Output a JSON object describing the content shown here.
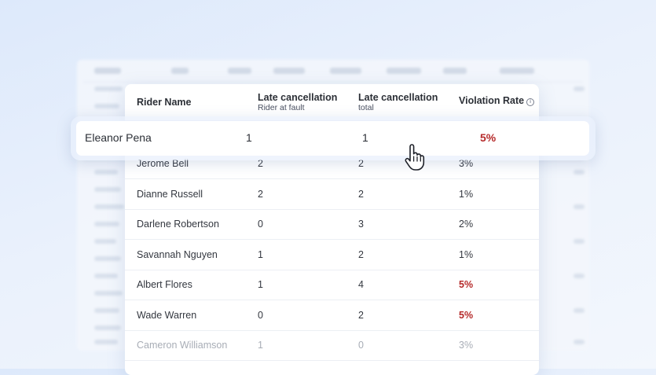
{
  "header": {
    "rider_name": "Rider Name",
    "late_fault_title": "Late cancellation",
    "late_fault_sub": "Rider at fault",
    "late_total_title": "Late cancellation",
    "late_total_sub": "total",
    "violation_rate": "Violation Rate",
    "info_icon": "info-icon"
  },
  "highlighted_row": {
    "name": "Eleanor Pena",
    "fault": "1",
    "total": "1",
    "rate": "5%"
  },
  "rows": [
    {
      "name": "Jerome Bell",
      "fault": "2",
      "total": "2",
      "rate": "3%"
    },
    {
      "name": "Dianne Russell",
      "fault": "2",
      "total": "2",
      "rate": "1%"
    },
    {
      "name": "Darlene Robertson",
      "fault": "0",
      "total": "3",
      "rate": "2%"
    },
    {
      "name": "Savannah Nguyen",
      "fault": "1",
      "total": "2",
      "rate": "1%"
    },
    {
      "name": "Albert Flores",
      "fault": "1",
      "total": "4",
      "rate": "5%"
    },
    {
      "name": "Wade Warren",
      "fault": "0",
      "total": "2",
      "rate": "5%"
    },
    {
      "name": "Cameron Williamson",
      "fault": "1",
      "total": "0",
      "rate": "3%"
    }
  ],
  "colors": {
    "violation": "#b52a2a",
    "accent_bg": "#dde9fb"
  }
}
